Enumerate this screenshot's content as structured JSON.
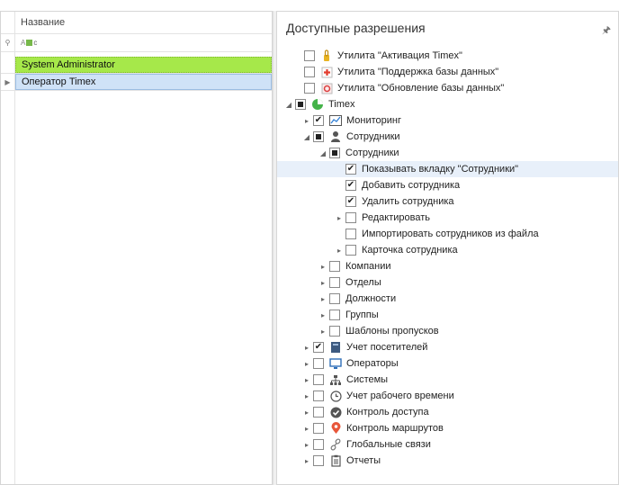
{
  "grid": {
    "header": "Название",
    "filter_text": "c",
    "rows": [
      {
        "label": "System Administrator"
      },
      {
        "label": "Оператор Timex"
      }
    ]
  },
  "panel": {
    "title": "Доступные разрешения"
  },
  "tree": [
    {
      "label": "Утилита \"Активация Timex\"",
      "level": 1,
      "expander": "none",
      "state": "unchecked",
      "icon": "key-icon"
    },
    {
      "label": "Утилита \"Поддержка базы данных\"",
      "level": 1,
      "expander": "none",
      "state": "unchecked",
      "icon": "database-support-icon"
    },
    {
      "label": "Утилита \"Обновление базы данных\"",
      "level": 1,
      "expander": "none",
      "state": "unchecked",
      "icon": "database-update-icon"
    },
    {
      "label": "Timex",
      "level": 0,
      "expander": "expanded",
      "state": "partial",
      "icon": "timex-logo-icon"
    },
    {
      "label": "Мониторинг",
      "level": 2,
      "expander": "collapsed",
      "state": "checked",
      "icon": "monitoring-icon"
    },
    {
      "label": "Сотрудники",
      "level": 2,
      "expander": "expanded",
      "state": "partial",
      "icon": "employee-icon"
    },
    {
      "label": "Сотрудники",
      "level": 3,
      "expander": "expanded",
      "state": "partial",
      "icon": ""
    },
    {
      "label": "Показывать вкладку \"Сотрудники\"",
      "level": 4,
      "expander": "none",
      "state": "checked",
      "icon": "",
      "highlight": true
    },
    {
      "label": "Добавить сотрудника",
      "level": 4,
      "expander": "none",
      "state": "checked",
      "icon": ""
    },
    {
      "label": "Удалить сотрудника",
      "level": 4,
      "expander": "none",
      "state": "checked",
      "icon": ""
    },
    {
      "label": "Редактировать",
      "level": 4,
      "expander": "collapsed",
      "state": "unchecked",
      "icon": ""
    },
    {
      "label": "Импортировать сотрудников из файла",
      "level": 4,
      "expander": "none",
      "state": "unchecked",
      "icon": ""
    },
    {
      "label": "Карточка сотрудника",
      "level": 4,
      "expander": "collapsed",
      "state": "unchecked",
      "icon": ""
    },
    {
      "label": "Компании",
      "level": 3,
      "expander": "collapsed",
      "state": "unchecked",
      "icon": ""
    },
    {
      "label": "Отделы",
      "level": 3,
      "expander": "collapsed",
      "state": "unchecked",
      "icon": ""
    },
    {
      "label": "Должности",
      "level": 3,
      "expander": "collapsed",
      "state": "unchecked",
      "icon": ""
    },
    {
      "label": "Группы",
      "level": 3,
      "expander": "collapsed",
      "state": "unchecked",
      "icon": ""
    },
    {
      "label": "Шаблоны пропусков",
      "level": 3,
      "expander": "collapsed",
      "state": "unchecked",
      "icon": ""
    },
    {
      "label": "Учет посетителей",
      "level": 2,
      "expander": "collapsed",
      "state": "checked",
      "icon": "visitors-icon"
    },
    {
      "label": "Операторы",
      "level": 2,
      "expander": "collapsed",
      "state": "unchecked",
      "icon": "operators-icon"
    },
    {
      "label": "Системы",
      "level": 2,
      "expander": "collapsed",
      "state": "unchecked",
      "icon": "systems-icon"
    },
    {
      "label": "Учет рабочего времени",
      "level": 2,
      "expander": "collapsed",
      "state": "unchecked",
      "icon": "clock-icon"
    },
    {
      "label": "Контроль доступа",
      "level": 2,
      "expander": "collapsed",
      "state": "unchecked",
      "icon": "shield-icon"
    },
    {
      "label": "Контроль маршрутов",
      "level": 2,
      "expander": "collapsed",
      "state": "unchecked",
      "icon": "location-pin-icon"
    },
    {
      "label": "Глобальные связи",
      "level": 2,
      "expander": "collapsed",
      "state": "unchecked",
      "icon": "link-icon"
    },
    {
      "label": "Отчеты",
      "level": 2,
      "expander": "collapsed",
      "state": "unchecked",
      "icon": "report-icon"
    }
  ]
}
